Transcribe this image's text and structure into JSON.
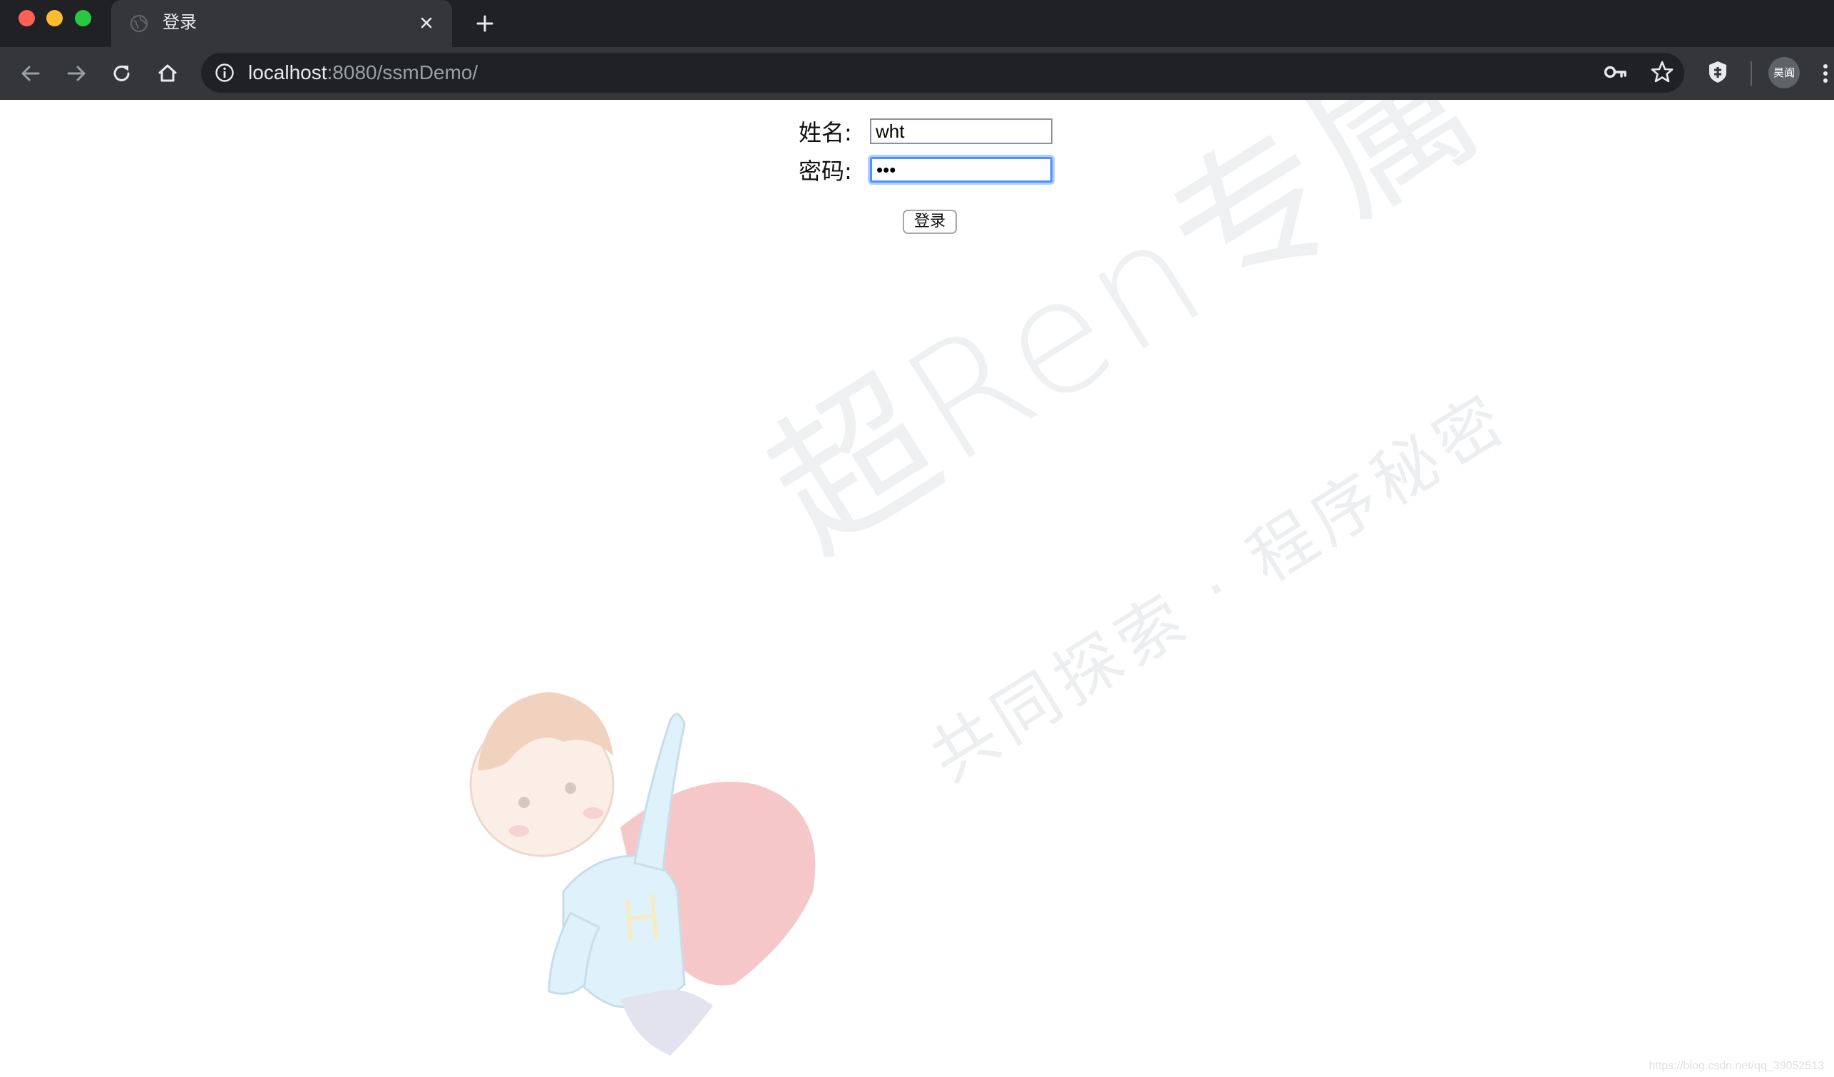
{
  "browser": {
    "tab_title": "登录",
    "url_host": "localhost",
    "url_rest": ":8080/ssmDemo/",
    "profile_initials": "昊阗"
  },
  "form": {
    "name_label": "姓名:",
    "name_value": "wht",
    "password_label": "密码:",
    "password_value": "•••",
    "login_button": "登录"
  },
  "watermark": {
    "line1": "超Ren专属",
    "line2": "共同探索 · 程序秘密"
  },
  "footer": {
    "credit": "https://blog.csdn.net/qq_39052513"
  },
  "colors": {
    "tabstrip_bg": "#202124",
    "toolbar_bg": "#35363a",
    "focus_ring": "#4d90fe"
  },
  "icons": [
    "globe-icon",
    "close-icon",
    "plus-icon",
    "back-arrow-icon",
    "forward-arrow-icon",
    "reload-icon",
    "home-icon",
    "info-icon",
    "key-icon",
    "star-icon",
    "extension-icon",
    "more-menu-icon"
  ]
}
